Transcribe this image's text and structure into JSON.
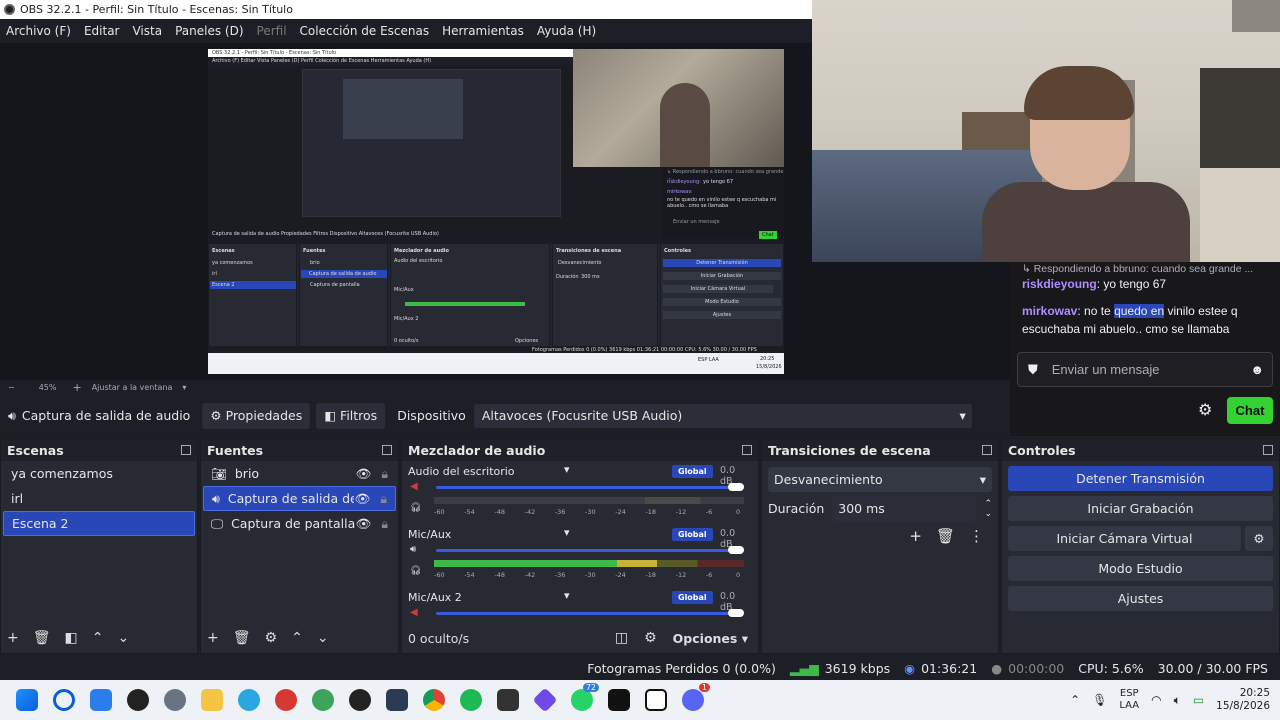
{
  "window": {
    "title": "OBS 32.2.1 - Perfil: Sin Título - Escenas: Sin Título"
  },
  "menu": [
    "Archivo (F)",
    "Editar",
    "Vista",
    "Paneles (D)",
    "Perfil",
    "Colección de Escenas",
    "Herramientas",
    "Ayuda (H)"
  ],
  "zoom": {
    "minus": "−",
    "value": "45%",
    "plus": "+",
    "fit": "Ajustar a la ventana"
  },
  "nested": {
    "title": "OBS 32.2.1 - Perfil: Sin Título - Escenas: Sin Título",
    "menu": "Archivo (F)  Editar  Vista  Paneles (D)  Perfil  Colección de Escenas  Herramientas  Ayuda (H)",
    "chat_reply": "↳ Respondiendo a bbruno: cuando sea grande ...",
    "chat_user1": "riskdieyoung:",
    "chat_msg1": "yo tengo 67",
    "chat_user2": "mirkowav:",
    "chat_msg2": "no te quedo en vinilo estee q escuchaba mi abuelo.. cmo se llamaba",
    "chat_input": "Enviar un mensaje",
    "chat_btn": "Chat",
    "toolbar": "Captura de salida de audio   Propiedades   Filtros   Dispositivo   Altavoces (Focusrite USB Audio)",
    "scenes_h": "Escenas",
    "scenes": [
      "ya comenzamos",
      "irl",
      "Escena 2"
    ],
    "sources_h": "Fuentes",
    "sources": [
      "brio",
      "Captura de salida de audio",
      "Captura de pantalla"
    ],
    "mixer_h": "Mezclador de audio",
    "mixer": [
      "Audio del escritorio",
      "Mic/Aux",
      "Mic/Aux 2"
    ],
    "mixer_foot": "0 oculto/s",
    "options": "Opciones",
    "trans_h": "Transiciones de escena",
    "trans": "Desvanecimiento",
    "duration": "Duración",
    "duration_val": "300 ms",
    "controls_h": "Controles",
    "controls": [
      "Detener Transmisión",
      "Iniciar Grabación",
      "Iniciar Cámara Virtual",
      "Modo Estudio",
      "Ajustes"
    ],
    "status": "Fotogramas Perdidos 0 (0.0%)   3619 kbps   01:36:21   00:00:00   CPU: 5.6%   30.00 / 30.00 FPS",
    "lang": "ESP LAA",
    "time": "20:25",
    "date": "15/8/2026"
  },
  "chat": {
    "reply": "Respondiendo a bbruno: cuando sea grande ...",
    "msg1_user": "riskdieyoung",
    "msg1_text": ": yo tengo 67",
    "msg2_user": "mirkowav",
    "msg2_a": ": no te ",
    "msg2_hl": "quedo en",
    "msg2_b": " vinilo estee q",
    "msg2_line2": "escuchaba mi abuelo.. cmo se llamaba",
    "input_placeholder": "Enviar un mensaje",
    "chat_button": "Chat",
    "user_color": "#b18cff"
  },
  "toolbar": {
    "source": "Captura de salida de audio",
    "properties": "Propiedades",
    "filters": "Filtros",
    "device_label": "Dispositivo",
    "device_value": "Altavoces (Focusrite USB Audio)"
  },
  "scenes": {
    "title": "Escenas",
    "items": [
      "ya comenzamos",
      "irl",
      "Escena 2"
    ],
    "selected": 2
  },
  "sources": {
    "title": "Fuentes",
    "items": [
      {
        "label": "brio",
        "icon": "camera-icon"
      },
      {
        "label": "Captura de salida de audio",
        "icon": "speaker-icon"
      },
      {
        "label": "Captura de pantalla",
        "icon": "monitor-icon"
      }
    ],
    "selected": 1
  },
  "mixer": {
    "title": "Mezclador de audio",
    "channels": [
      {
        "name": "Audio del escritorio",
        "badge": "Global",
        "db": "0.0 dB",
        "muted": true,
        "volume": 1.0
      },
      {
        "name": "Mic/Aux",
        "badge": "Global",
        "db": "0.0 dB",
        "muted": false,
        "volume": 1.0
      },
      {
        "name": "Mic/Aux 2",
        "badge": "Global",
        "db": "0.0 dB",
        "muted": true,
        "volume": 1.0
      }
    ],
    "scale": [
      "-60",
      "-54",
      "-48",
      "-42",
      "-36",
      "-30",
      "-24",
      "-18",
      "-12",
      "-6",
      "0"
    ],
    "hidden": "0 oculto/s",
    "options": "Opciones"
  },
  "transitions": {
    "title": "Transiciones de escena",
    "selected": "Desvanecimiento",
    "duration_label": "Duración",
    "duration_value": "300 ms"
  },
  "controls": {
    "title": "Controles",
    "buttons": [
      "Detener Transmisión",
      "Iniciar Grabación",
      "Iniciar Cámara Virtual",
      "Modo Estudio",
      "Ajustes"
    ],
    "accent": "#2a47b8"
  },
  "status": {
    "dropped": "Fotogramas Perdidos 0 (0.0%)",
    "bitrate": "3619 kbps",
    "stream_time": "01:36:21",
    "rec_time": "00:00:00",
    "cpu": "CPU: 5.6%",
    "fps": "30.00 / 30.00 FPS"
  },
  "taskbar": {
    "lang1": "ESP",
    "lang2": "LAA",
    "time": "20:25",
    "date": "15/8/2026",
    "badge_whatsapp": "72",
    "badge_discord": "1"
  }
}
